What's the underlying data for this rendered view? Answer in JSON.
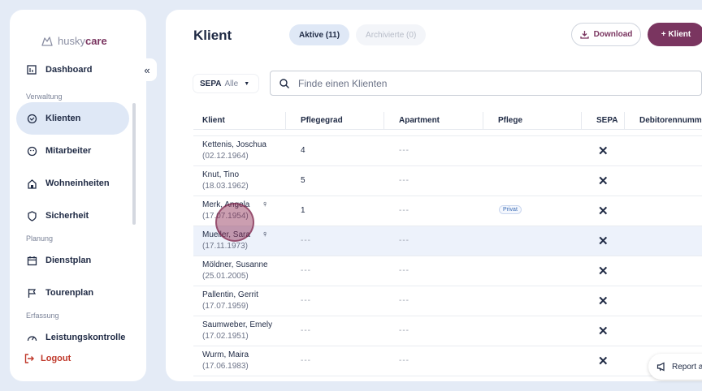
{
  "brand": {
    "name_part1": "husky",
    "name_part2": "care"
  },
  "sidebar": {
    "items": [
      {
        "label": "Dashboard",
        "icon": "dashboard-icon"
      },
      {
        "label": "Klienten",
        "icon": "klienten-icon",
        "active": true
      },
      {
        "label": "Mitarbeiter",
        "icon": "mitarbeiter-icon"
      },
      {
        "label": "Wohneinheiten",
        "icon": "wohneinheiten-icon"
      },
      {
        "label": "Sicherheit",
        "icon": "shield-icon"
      },
      {
        "label": "Dienstplan",
        "icon": "calendar-icon"
      },
      {
        "label": "Tourenplan",
        "icon": "flag-icon"
      },
      {
        "label": "Leistungskontrolle",
        "icon": "gauge-icon"
      }
    ],
    "sections": [
      "Verwaltung",
      "Planung",
      "Erfassung"
    ],
    "logout_label": "Logout",
    "collapse_glyph": "«"
  },
  "header": {
    "title": "Klient",
    "tabs": [
      {
        "label": "Aktive (11)",
        "active": true
      },
      {
        "label": "Archivierte (0)",
        "active": false
      }
    ],
    "download_label": "Download",
    "add_label": "+ Klient"
  },
  "filter": {
    "sepa_key": "SEPA",
    "sepa_value": "Alle"
  },
  "search": {
    "placeholder": "Finde einen Klienten"
  },
  "table": {
    "columns": [
      "Klient",
      "Pflegegrad",
      "Apartment",
      "Pflege",
      "SEPA",
      "Debitorennumm"
    ],
    "rows": [
      {
        "name": "Kettenis, Joschua",
        "dob": "(02.12.1964)",
        "pflegegrad": "4",
        "apartment": "---",
        "pflege": "",
        "sepa": "✕",
        "female": false
      },
      {
        "name": "Knut, Tino",
        "dob": "(18.03.1962)",
        "pflegegrad": "5",
        "apartment": "---",
        "pflege": "",
        "sepa": "✕",
        "female": false
      },
      {
        "name": "Merk, Angela",
        "dob": "(17.07.1954)",
        "pflegegrad": "1",
        "apartment": "---",
        "pflege": "Privat",
        "sepa": "✕",
        "female": true
      },
      {
        "name": "Mueller, Sara",
        "dob": "(17.11.1973)",
        "pflegegrad": "---",
        "apartment": "---",
        "pflege": "",
        "sepa": "✕",
        "female": true,
        "highlight": true
      },
      {
        "name": "Möldner, Susanne",
        "dob": "(25.01.2005)",
        "pflegegrad": "---",
        "apartment": "---",
        "pflege": "",
        "sepa": "✕",
        "female": false
      },
      {
        "name": "Pallentin, Gerrit",
        "dob": "(17.07.1959)",
        "pflegegrad": "---",
        "apartment": "---",
        "pflege": "",
        "sepa": "✕",
        "female": false
      },
      {
        "name": "Saumweber, Emely",
        "dob": "(17.02.1951)",
        "pflegegrad": "---",
        "apartment": "---",
        "pflege": "",
        "sepa": "✕",
        "female": false
      },
      {
        "name": "Wurm, Maira",
        "dob": "(17.06.1983)",
        "pflegegrad": "---",
        "apartment": "---",
        "pflege": "",
        "sepa": "✕",
        "female": false
      }
    ]
  },
  "report": {
    "label": "Report a"
  },
  "colors": {
    "brand": "#7a3560",
    "active_bg": "#dfe8f6",
    "logout": "#c0392b"
  }
}
